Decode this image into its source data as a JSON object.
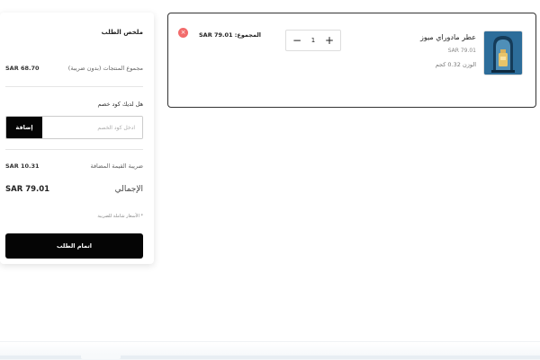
{
  "summary": {
    "title": "ملخص الطلب",
    "subtotal_label": "مجموع المنتجات (بدون ضريبة)",
    "subtotal_value": "SAR 68.70",
    "coupon_label": "هل لديك كود خصم",
    "coupon_placeholder": "ادخل كود الخصم",
    "coupon_button": "إضافة",
    "vat_label": "ضريبة القيمة المضافة",
    "vat_value": "SAR 10.31",
    "total_label": "الإجمالي",
    "total_value": "SAR 79.01",
    "note": "* الأسعار شاملة للضريبة",
    "checkout_button": "اتمام الطلب"
  },
  "cart": {
    "items": [
      {
        "name": "عطر مادوراي ميوز",
        "price": "SAR 79.01",
        "weight": "الوزن 0.32 كجم",
        "quantity": "1",
        "line_total": "المجموع: SAR 79.01",
        "thumbnail_icon": "perfume-bottle-icon"
      }
    ]
  },
  "icons": {
    "minus": "−",
    "plus": "+",
    "remove": "×"
  },
  "colors": {
    "primary_button": "#050505",
    "remove_button": "#f26b6b",
    "thumbnail_bg": "#2d6d9a"
  }
}
